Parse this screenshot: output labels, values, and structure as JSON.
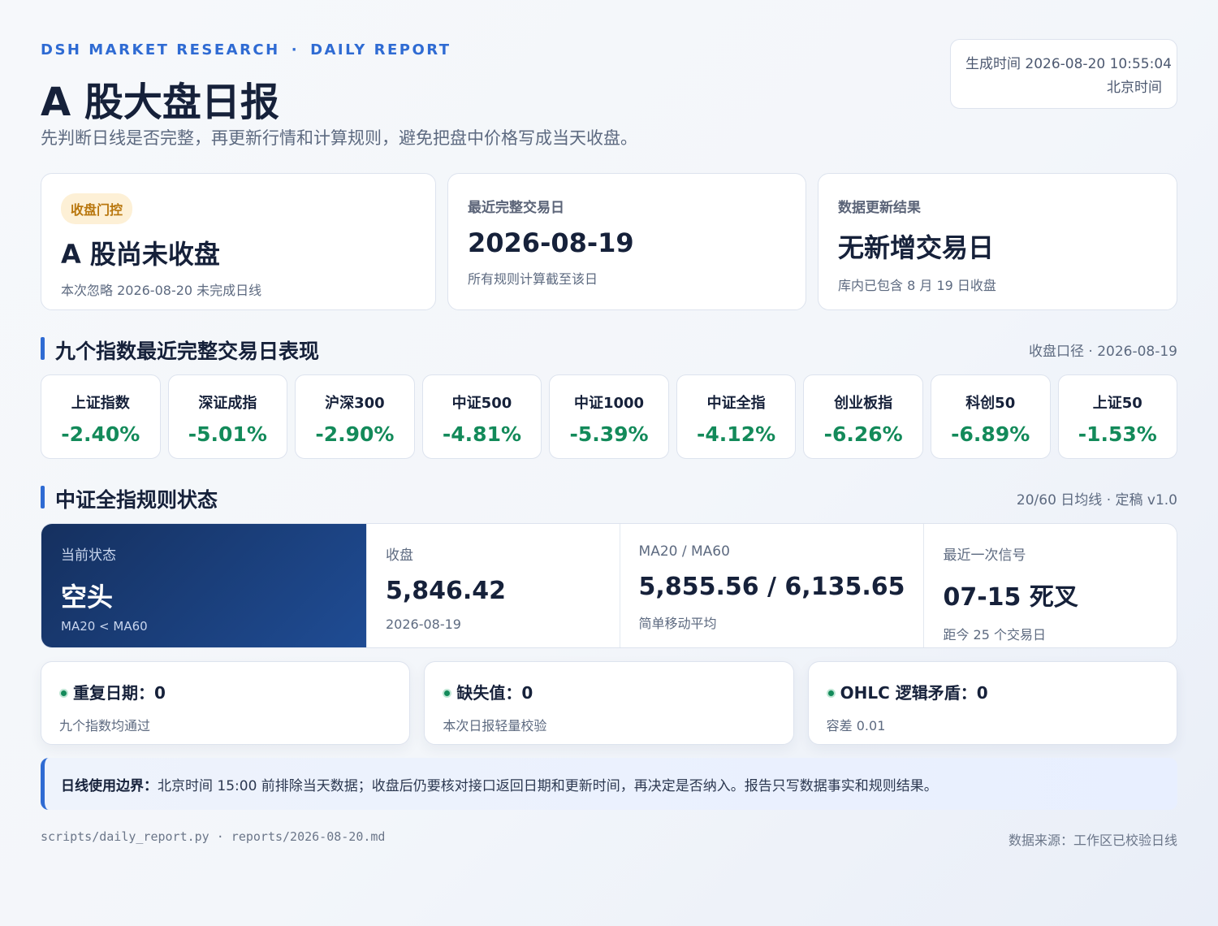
{
  "header": {
    "kicker_left": "DSH MARKET RESEARCH",
    "kicker_sep": "·",
    "kicker_right": "DAILY REPORT",
    "title": "A 股大盘日报",
    "subtitle": "先判断日线是否完整，再更新行情和计算规则，避免把盘中价格写成当天收盘。",
    "generated_at": "生成时间 2026-08-20 10:55:04",
    "timezone": "北京时间"
  },
  "summary_cards": [
    {
      "badge": "收盘门控",
      "value": "A 股尚未收盘",
      "note": "本次忽略 2026-08-20 未完成日线"
    },
    {
      "label": "最近完整交易日",
      "value": "2026-08-19",
      "note": "所有规则计算截至该日"
    },
    {
      "label": "数据更新结果",
      "value": "无新增交易日",
      "note": "库内已包含 8 月 19 日收盘"
    }
  ],
  "indices_section": {
    "title": "九个指数最近完整交易日表现",
    "meta": "收盘口径 · 2026-08-19",
    "items": [
      {
        "name": "上证指数",
        "change": "-2.40%"
      },
      {
        "name": "深证成指",
        "change": "-5.01%"
      },
      {
        "name": "沪深300",
        "change": "-2.90%"
      },
      {
        "name": "中证500",
        "change": "-4.81%"
      },
      {
        "name": "中证1000",
        "change": "-5.39%"
      },
      {
        "name": "中证全指",
        "change": "-4.12%"
      },
      {
        "name": "创业板指",
        "change": "-6.26%"
      },
      {
        "name": "科创50",
        "change": "-6.89%"
      },
      {
        "name": "上证50",
        "change": "-1.53%"
      }
    ],
    "down_color": "#138a5a"
  },
  "rules_section": {
    "title": "中证全指规则状态",
    "meta": "20/60 日均线 · 定稿 v1.0",
    "primary": {
      "label": "当前状态",
      "value": "空头",
      "sub": "MA20 < MA60"
    },
    "cells": [
      {
        "label": "收盘",
        "value": "5,846.42",
        "sub": "2026-08-19"
      },
      {
        "label": "MA20 / MA60",
        "value": "5,855.56 / 6,135.65",
        "sub": "简单移动平均"
      },
      {
        "label": "最近一次信号",
        "value": "07-15 死叉",
        "sub": "距今 25 个交易日"
      }
    ]
  },
  "checks": [
    {
      "head": "重复日期：0",
      "sub": "九个指数均通过"
    },
    {
      "head": "缺失值：0",
      "sub": "本次日报轻量校验"
    },
    {
      "head": "OHLC 逻辑矛盾：0",
      "sub": "容差 0.01"
    }
  ],
  "note": {
    "label": "日线使用边界：",
    "text": "北京时间 15:00 前排除当天数据；收盘后仍要核对接口返回日期和更新时间，再决定是否纳入。报告只写数据事实和规则结果。"
  },
  "footer": {
    "paths": "scripts/daily_report.py · reports/2026-08-20.md",
    "source": "数据来源：工作区已校验日线"
  },
  "colors": {
    "accent": "#2f6bd3",
    "badge_bg": "#fdf0d6",
    "badge_text": "#b9770e",
    "primary_panel": "#1f4c94"
  }
}
